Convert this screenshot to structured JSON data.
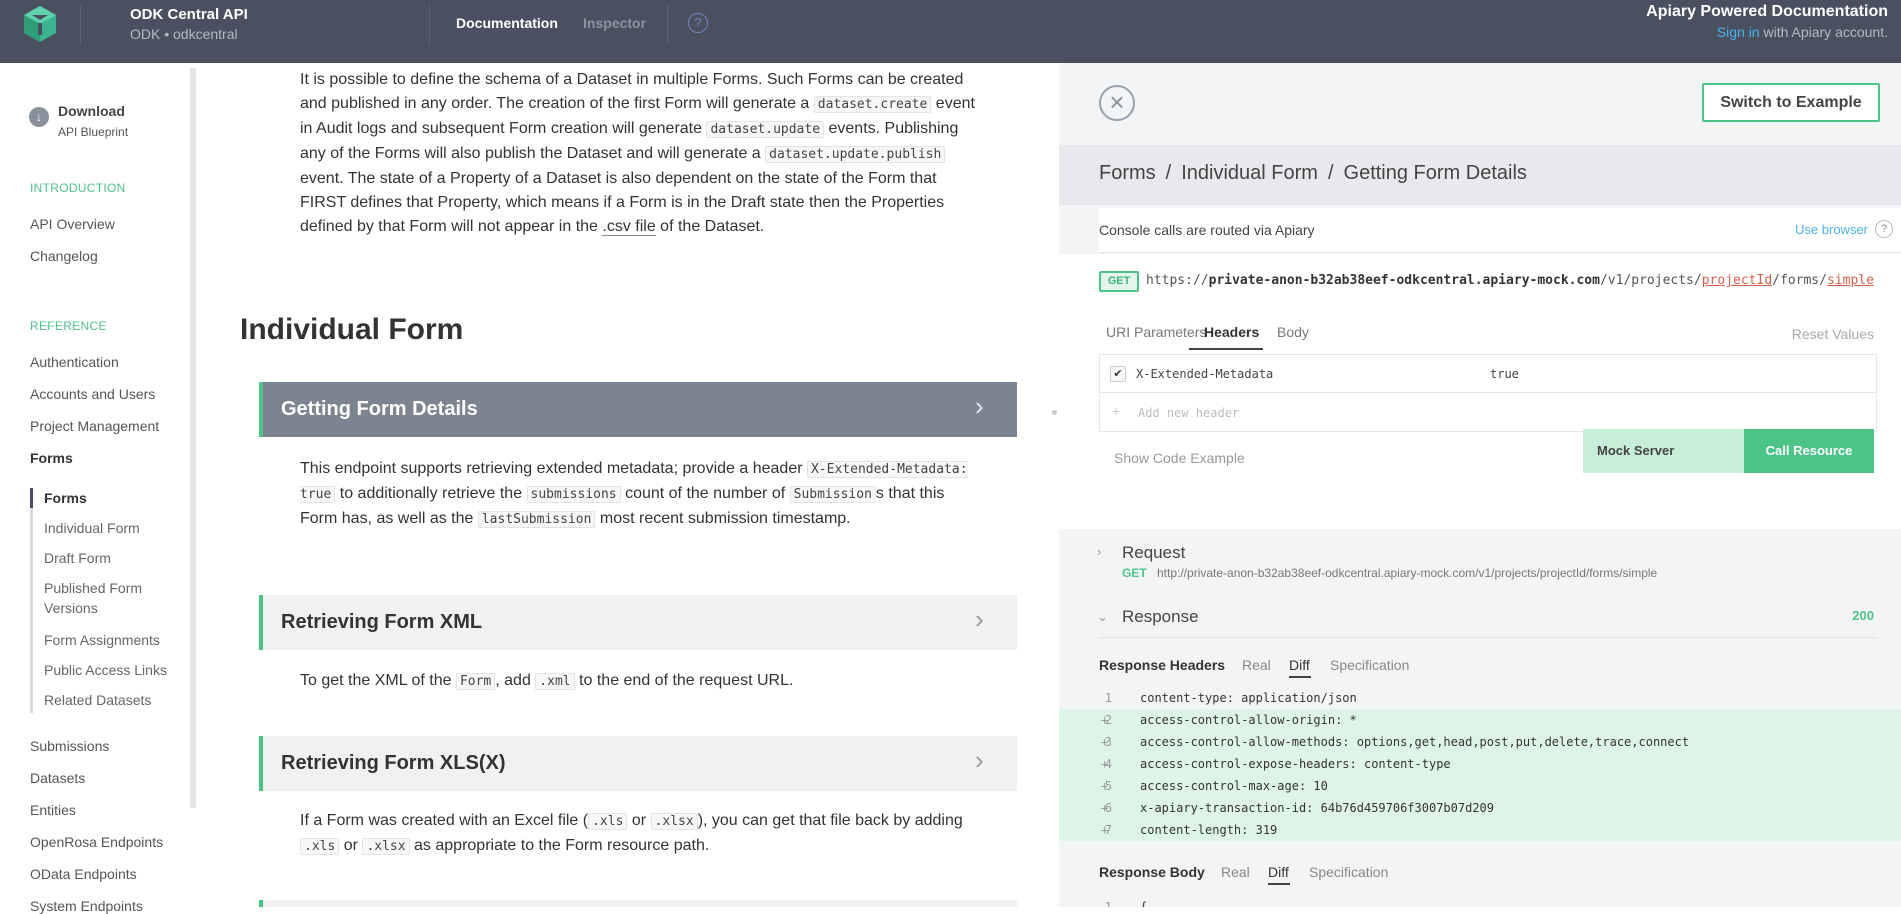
{
  "topbar": {
    "app_title": "ODK Central API",
    "app_subtitle": "ODK • odkcentral",
    "nav_documentation": "Documentation",
    "nav_inspector": "Inspector",
    "help_glyph": "?",
    "apiary_title": "Apiary Powered Documentation",
    "sign_in": "Sign in",
    "sign_in_suffix": " with Apiary account."
  },
  "sidebar": {
    "download_label": "Download",
    "download_sub": "API Blueprint",
    "introduction_heading": "INTRODUCTION",
    "intro_items": [
      "API Overview",
      "Changelog"
    ],
    "reference_heading": "REFERENCE",
    "reference_items": [
      "Authentication",
      "Accounts and Users",
      "Project Management",
      "Forms"
    ],
    "forms_subitems": [
      "Forms",
      "Individual Form",
      "Draft Form",
      "Published Form Versions",
      "Form Assignments",
      "Public Access Links",
      "Related Datasets"
    ],
    "more_items": [
      "Submissions",
      "Datasets",
      "Entities",
      "OpenRosa Endpoints",
      "OData Endpoints",
      "System Endpoints"
    ]
  },
  "content": {
    "intro_paragraph": {
      "t1": "It is possible to define the schema of a Dataset in multiple Forms. Such Forms can be created and published in any order. The creation of the first Form will generate a ",
      "c1": "dataset.create",
      "t2": " event in Audit logs and subsequent Form creation will generate ",
      "c2": "dataset.update",
      "t3": " events. Publishing any of the Forms will also publish the Dataset and will generate a ",
      "c3": "dataset.update.publish",
      "t4": " event. The state of a Property of a Dataset is also dependent on the state of the Form that FIRST defines that Property, which means if a Form is in the Draft state then the Properties defined by that Form will not appear in the ",
      "link": ".csv file",
      "t5": " of the Dataset."
    },
    "section_title": "Individual Form",
    "getting": {
      "title": "Getting Form Details",
      "t1": "This endpoint supports retrieving extended metadata; provide a header ",
      "c1": "X-Extended-Metadata: true",
      "t2": " to additionally retrieve the ",
      "c2": "submissions",
      "t3": " count of the number of ",
      "c3": "Submission",
      "t4": "s that this Form has, as well as the ",
      "c4": "lastSubmission",
      "t5": " most recent submission timestamp."
    },
    "xml": {
      "title": "Retrieving Form XML",
      "t1": "To get the XML of the ",
      "c1": "Form",
      "t2": ", add ",
      "c2": ".xml",
      "t3": " to the end of the request URL."
    },
    "xls": {
      "title": "Retrieving Form XLS(X)",
      "t1": "If a Form was created with an Excel file (",
      "c1": ".xls",
      "t2": " or ",
      "c2": ".xlsx",
      "t3": "), you can get that file back by adding ",
      "c3": ".xls",
      "t4": " or ",
      "c4": ".xlsx",
      "t5": " as appropriate to the Form resource path."
    }
  },
  "panel": {
    "close_glyph": "×",
    "switch_label": "Switch to Example",
    "breadcrumb": [
      "Forms",
      "Individual Form",
      "Getting Form Details"
    ],
    "breadcrumb_sep": "/",
    "routed_text": "Console calls are routed via Apiary",
    "use_browser": "Use browser",
    "method": "GET",
    "url": {
      "scheme": "https://",
      "host": "private-anon-b32ab38eef-odkcentral.apiary-mock.com",
      "path1": "/v1/projects/",
      "param1": "projectId",
      "path2": "/forms/",
      "param2": "simple"
    },
    "console_tabs": [
      "URI Parameters",
      "Headers",
      "Body"
    ],
    "reset_values": "Reset Values",
    "header_name": "X-Extended-Metadata",
    "header_value": "true",
    "check_glyph": "✔",
    "add_header_placeholder": "Add new header",
    "show_code": "Show Code Example",
    "mock_server": "Mock Server",
    "call_resource": "Call Resource",
    "request_title": "Request",
    "request_method": "GET",
    "request_url": "http://private-anon-b32ab38eef-odkcentral.apiary-mock.com/v1/projects/projectId/forms/simple",
    "response_title": "Response",
    "status_code": "200",
    "response_headers_label": "Response Headers",
    "response_body_label": "Response Body",
    "view_tabs": [
      "Real",
      "Diff",
      "Specification"
    ],
    "header_lines": [
      {
        "n": "1",
        "text": "content-type: application/json",
        "added": false
      },
      {
        "n": "2",
        "text": "access-control-allow-origin: *",
        "added": true
      },
      {
        "n": "3",
        "text": "access-control-allow-methods: options,get,head,post,put,delete,trace,connect",
        "added": true
      },
      {
        "n": "4",
        "text": "access-control-expose-headers: content-type",
        "added": true
      },
      {
        "n": "5",
        "text": "access-control-max-age: 10",
        "added": true
      },
      {
        "n": "6",
        "text": "x-apiary-transaction-id: 64b76d459706f3007b07d209",
        "added": true
      },
      {
        "n": "7",
        "text": "content-length: 319",
        "added": true
      }
    ],
    "body_first_line": {
      "n": "1",
      "text": "{"
    }
  }
}
